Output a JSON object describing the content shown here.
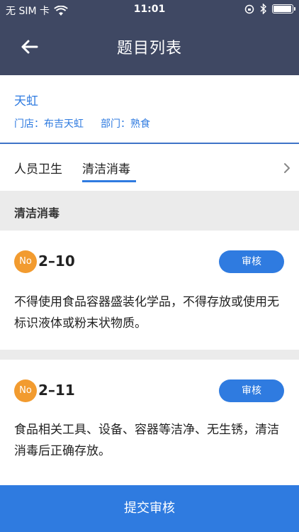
{
  "status_bar": {
    "carrier": "无 SIM 卡",
    "time": "11:01"
  },
  "nav": {
    "title": "题目列表",
    "back_icon": "arrow-left-icon"
  },
  "store": {
    "name": "天虹",
    "store_label": "门店：布吉天虹",
    "dept_label": "部门：熟食"
  },
  "tabs": {
    "items": [
      {
        "label": "人员卫生",
        "active": false
      },
      {
        "label": "清洁消毒",
        "active": true
      }
    ]
  },
  "section": {
    "title": "清洁消毒"
  },
  "items": [
    {
      "badge": "No",
      "code": "2–10",
      "button": "审核",
      "text": "不得使用食品容器盛装化学品，不得存放或使用无标识液体或粉末状物质。"
    },
    {
      "badge": "No",
      "code": "2–11",
      "button": "审核",
      "text": "食品相关工具、设备、容器等洁净、无生锈，清洁消毒后正确存放。"
    }
  ],
  "submit_label": "提交审核",
  "colors": {
    "nav_bg": "#3f4863",
    "accent": "#2f7be0",
    "badge": "#f29b2f"
  }
}
